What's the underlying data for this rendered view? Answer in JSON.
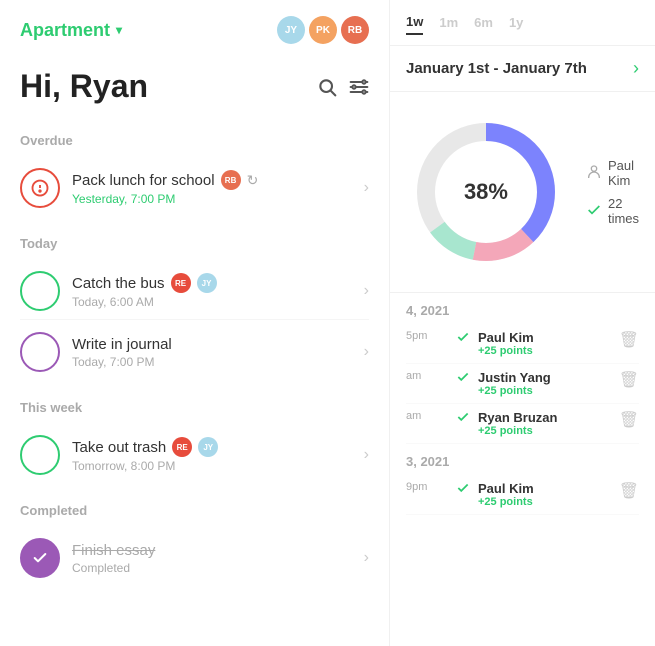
{
  "app": {
    "title": "Apartment",
    "dropdown_arrow": "▾"
  },
  "users": [
    {
      "initials": "JY",
      "color_class": "avatar-jy"
    },
    {
      "initials": "PK",
      "color_class": "avatar-pk"
    },
    {
      "initials": "RB",
      "color_class": "avatar-rb"
    }
  ],
  "greeting": "Hi, Ryan",
  "icons": {
    "search": "🔍",
    "filter": "⚙"
  },
  "sections": {
    "overdue_label": "Overdue",
    "today_label": "Today",
    "this_week_label": "This week",
    "completed_label": "Completed"
  },
  "tasks": {
    "overdue": [
      {
        "name": "Pack lunch for school",
        "time": "Yesterday, 7:00 PM",
        "assignee": "RB",
        "repeat": true
      }
    ],
    "today": [
      {
        "name": "Catch the bus",
        "time": "Today, 6:00 AM",
        "assignees": [
          "RE",
          "JY"
        ]
      },
      {
        "name": "Write in journal",
        "time": "Today, 7:00 PM",
        "assignees": []
      }
    ],
    "this_week": [
      {
        "name": "Take out trash",
        "time": "Tomorrow, 8:00 PM",
        "assignees": [
          "RE",
          "JY"
        ]
      }
    ],
    "completed": [
      {
        "name": "Finish essay",
        "time": "Completed",
        "completed": true
      }
    ]
  },
  "right_panel": {
    "time_tabs": [
      {
        "label": "1w",
        "active": true
      },
      {
        "label": "1m",
        "active": false
      },
      {
        "label": "6m",
        "active": false
      },
      {
        "label": "1y",
        "active": false
      }
    ],
    "date_range": "January 1st - January 7th",
    "chart": {
      "percent": "38%",
      "segments": [
        {
          "color": "#7c83fd",
          "pct": 38
        },
        {
          "color": "#e8e8e8",
          "pct": 35
        },
        {
          "color": "#f4a7b9",
          "pct": 15
        },
        {
          "color": "#a8e6cf",
          "pct": 12
        }
      ],
      "legend": [
        {
          "icon": "👤",
          "text": "Paul Kim"
        },
        {
          "icon": "✓",
          "text": "22 times"
        }
      ]
    },
    "activity_groups": [
      {
        "date": "4, 2021",
        "entries": [
          {
            "time": "5pm",
            "name": "Paul Kim",
            "points": "+25 points"
          },
          {
            "time": "am",
            "name": "Justin Yang",
            "points": "+25 points"
          },
          {
            "time": "am",
            "name": "Ryan Bruzan",
            "points": "+25 points"
          }
        ]
      },
      {
        "date": "3, 2021",
        "entries": [
          {
            "time": "9pm",
            "name": "Paul Kim",
            "points": "+25 points"
          }
        ]
      }
    ]
  }
}
